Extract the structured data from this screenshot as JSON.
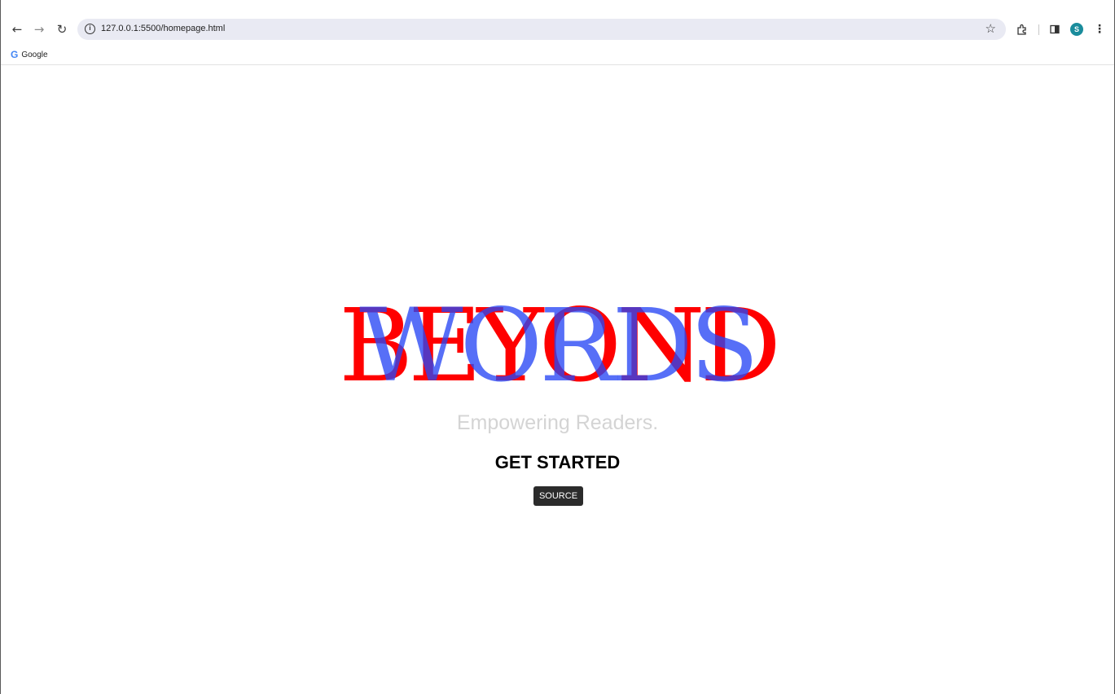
{
  "browser": {
    "back_icon": "arrow-left",
    "forward_icon": "arrow-right",
    "reload_icon": "reload",
    "url": "127.0.0.1:5500/homepage.html",
    "site_info_glyph": "i",
    "profile_initial": "S",
    "accent_color": "#1a8c9c"
  },
  "bookmarks": {
    "items": [
      {
        "label": "Google",
        "icon": "G"
      }
    ]
  },
  "page": {
    "hero_word_red": "BEYOND",
    "hero_word_blue": "WORDS",
    "hero_red_color": "#ff0000",
    "hero_blue_color": "#2846f5",
    "tagline": "Empowering Readers.",
    "cta_label": "GET STARTED",
    "source_label": "SOURCE"
  }
}
